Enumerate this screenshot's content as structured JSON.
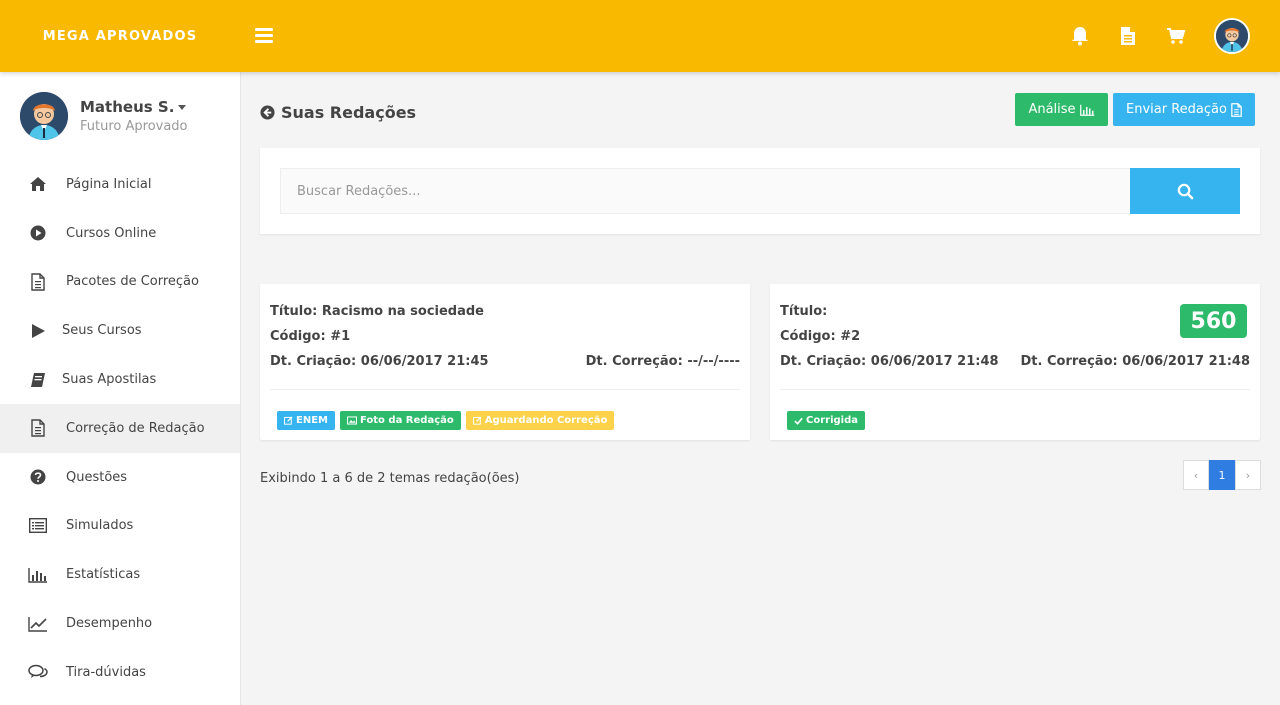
{
  "header": {
    "brand": "MEGA APROVADOS",
    "icons": [
      "menu-icon",
      "bell-icon",
      "document-icon",
      "cart-icon",
      "user-avatar"
    ]
  },
  "sidebar": {
    "user_name": "Matheus S.",
    "user_role": "Futuro Aprovado",
    "items": [
      {
        "label": "Página Inicial",
        "icon": "home-icon"
      },
      {
        "label": "Cursos Online",
        "icon": "play-circle-icon"
      },
      {
        "label": "Pacotes de Correção",
        "icon": "file-icon"
      },
      {
        "label": "Seus Cursos",
        "icon": "play-icon"
      },
      {
        "label": "Suas Apostilas",
        "icon": "book-icon"
      },
      {
        "label": "Correção de Redação",
        "icon": "file-icon",
        "active": true
      },
      {
        "label": "Questões",
        "icon": "question-icon"
      },
      {
        "label": "Simulados",
        "icon": "list-icon"
      },
      {
        "label": "Estatísticas",
        "icon": "bar-chart-icon"
      },
      {
        "label": "Desempenho",
        "icon": "line-chart-icon"
      },
      {
        "label": "Tira-dúvidas",
        "icon": "chat-icon"
      }
    ]
  },
  "main": {
    "title": "Suas Redações",
    "analise_label": "Análise",
    "enviar_label": "Enviar Redação",
    "search_placeholder": "Buscar Redações...",
    "cards": [
      {
        "titulo": "Título: Racismo na sociedade",
        "codigo": "Código: #1",
        "dt_criacao": "Dt. Criação: 06/06/2017 21:45",
        "dt_correcao": "Dt. Correção: --/--/----",
        "badges": [
          "ENEM",
          "Foto da Redação",
          "Aguardando Correção"
        ]
      },
      {
        "titulo": "Título:",
        "codigo": "Código: #2",
        "dt_criacao": "Dt. Criação: 06/06/2017 21:48",
        "dt_correcao": "Dt. Correção: 06/06/2017 21:48",
        "score": "560",
        "badges": [
          "Corrigida"
        ]
      }
    ],
    "pagination_info": "Exibindo 1 a 6 de 2 temas redação(ões)",
    "pagination": {
      "prev": "‹",
      "current": "1",
      "next": "›"
    }
  },
  "colors": {
    "header": "#f8b900",
    "green": "#2dbb6b",
    "blue": "#36b4f0",
    "yellow": "#fcd24a",
    "page_active": "#2f7de1"
  }
}
